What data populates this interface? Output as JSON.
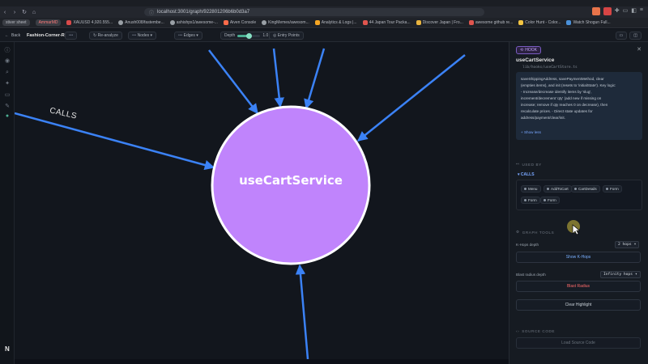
{
  "browser": {
    "url": "localhost:3001/graph/922801206b6b0d3a7",
    "bookmarks": [
      {
        "label": "stiver sheet",
        "style": "pill"
      },
      {
        "label": "AmmarMD",
        "style": "pill-red"
      },
      {
        "label": "XAUUSD 4,920.555...",
        "color": "#d94a4a"
      },
      {
        "label": "Anush008/fastembe...",
        "color": "#9aa0a6"
      },
      {
        "label": "ashishps1/awesome-...",
        "color": "#9aa0a6"
      },
      {
        "label": "Aiven Console",
        "color": "#ff6b4a"
      },
      {
        "label": "KingMemes/awesom...",
        "color": "#9aa0a6"
      },
      {
        "label": "Analytics & Logs |...",
        "color": "#f6a623"
      },
      {
        "label": "44 Japan Tour Packa...",
        "color": "#e0554e"
      },
      {
        "label": "Discover Japan | Fro...",
        "color": "#e9b43f"
      },
      {
        "label": "awesome github re...",
        "color": "#e0554e"
      },
      {
        "label": "Color Hunt - Color...",
        "color": "#f4c542"
      },
      {
        "label": "Watch Shogun Full...",
        "color": "#4a90d9"
      }
    ]
  },
  "toolbar": {
    "back_label": "Back",
    "project_name": "Fashion-Corner-Re...",
    "reanalyze_label": "Re-analyze",
    "nodes_label": "Nodes",
    "edges_label": "Edges",
    "depth_label": "Depth",
    "depth_value": "1.0",
    "depth_fraction": 0.5,
    "entry_points_label": "Entry Points"
  },
  "graph": {
    "center_node": "useCartService",
    "node_color": "#c084fc",
    "edge_color": "#3b82f6",
    "edge_label": "CALLS"
  },
  "panel": {
    "kind_badge": "HOOK",
    "title": "useCartService",
    "path": "lib/hooks/useCartStore.ts",
    "summary_lines": [
      "saveShippingAddress, savePaymentMethod, clear",
      "(empties items), and init (resets to 'initialState'). Key logic:",
      "- Increase/decrease identify items by 'slug',",
      "increment/decrement 'qty' (add new if missing on",
      "increase; remove if qty reaches 0 on decrease), then",
      "recalculate prices. - Direct state updates for",
      "address/payment/clear/init."
    ],
    "show_less": "Show less",
    "used_by_header": "USED BY",
    "calls_label": "CALLS",
    "calls_items": [
      "Menu",
      "AddToCart",
      "CartDetails",
      "Form",
      "Form",
      "Form"
    ],
    "graph_tools_header": "GRAPH TOOLS",
    "khops_label": "K-Hops depth",
    "khops_value": "2 hops",
    "show_khops": "Show K-Hops",
    "blast_label": "Blast radius depth",
    "blast_value": "Infinity hops",
    "blast_button": "Blast Radius",
    "clear_highlight": "Clear Highlight",
    "source_code_header": "SOURCE CODE",
    "load_source": "Load Source Code"
  }
}
